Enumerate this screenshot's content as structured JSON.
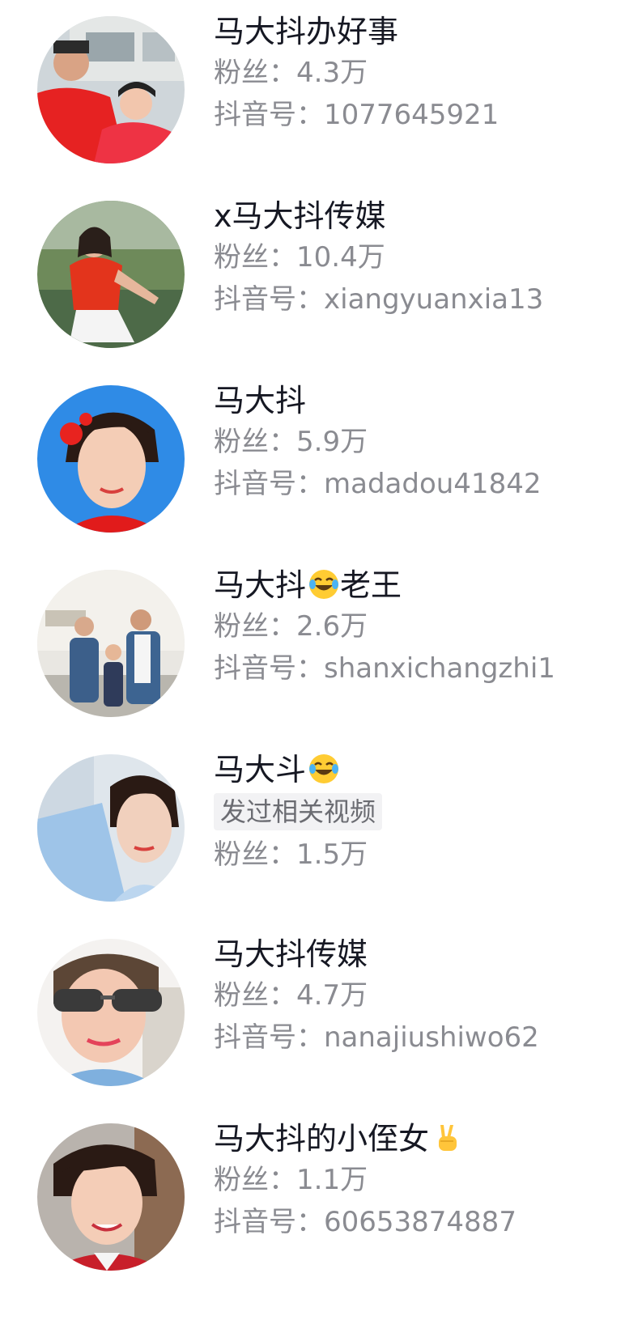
{
  "labels": {
    "fans": "粉丝：",
    "douyin_id": "抖音号："
  },
  "users": [
    {
      "name": "马大抖办好事",
      "fans": "4.3万",
      "douyin_id": "1077645921",
      "emoji": ""
    },
    {
      "name": "x马大抖传媒",
      "fans": "10.4万",
      "douyin_id": "xiangyuanxia13",
      "emoji": ""
    },
    {
      "name": "马大抖",
      "fans": "5.9万",
      "douyin_id": "madadou41842",
      "emoji": ""
    },
    {
      "name": "马大抖",
      "name_suffix": "老王",
      "fans": "2.6万",
      "douyin_id": "shanxichangzhi1",
      "emoji": "laughing-tears-emoji"
    },
    {
      "name": "马大斗",
      "tag": "发过相关视频",
      "fans": "1.5万",
      "emoji": "laughing-tears-emoji"
    },
    {
      "name": "马大抖传媒",
      "fans": "4.7万",
      "douyin_id": "nanajiushiwo62",
      "emoji": ""
    },
    {
      "name": "马大抖的小侄女",
      "fans": "1.1万",
      "douyin_id": "60653874887",
      "emoji": "victory-hand-emoji"
    }
  ],
  "colors": {
    "name": "#161823",
    "meta": "#8a8b91",
    "tag_bg": "#f2f2f4"
  }
}
